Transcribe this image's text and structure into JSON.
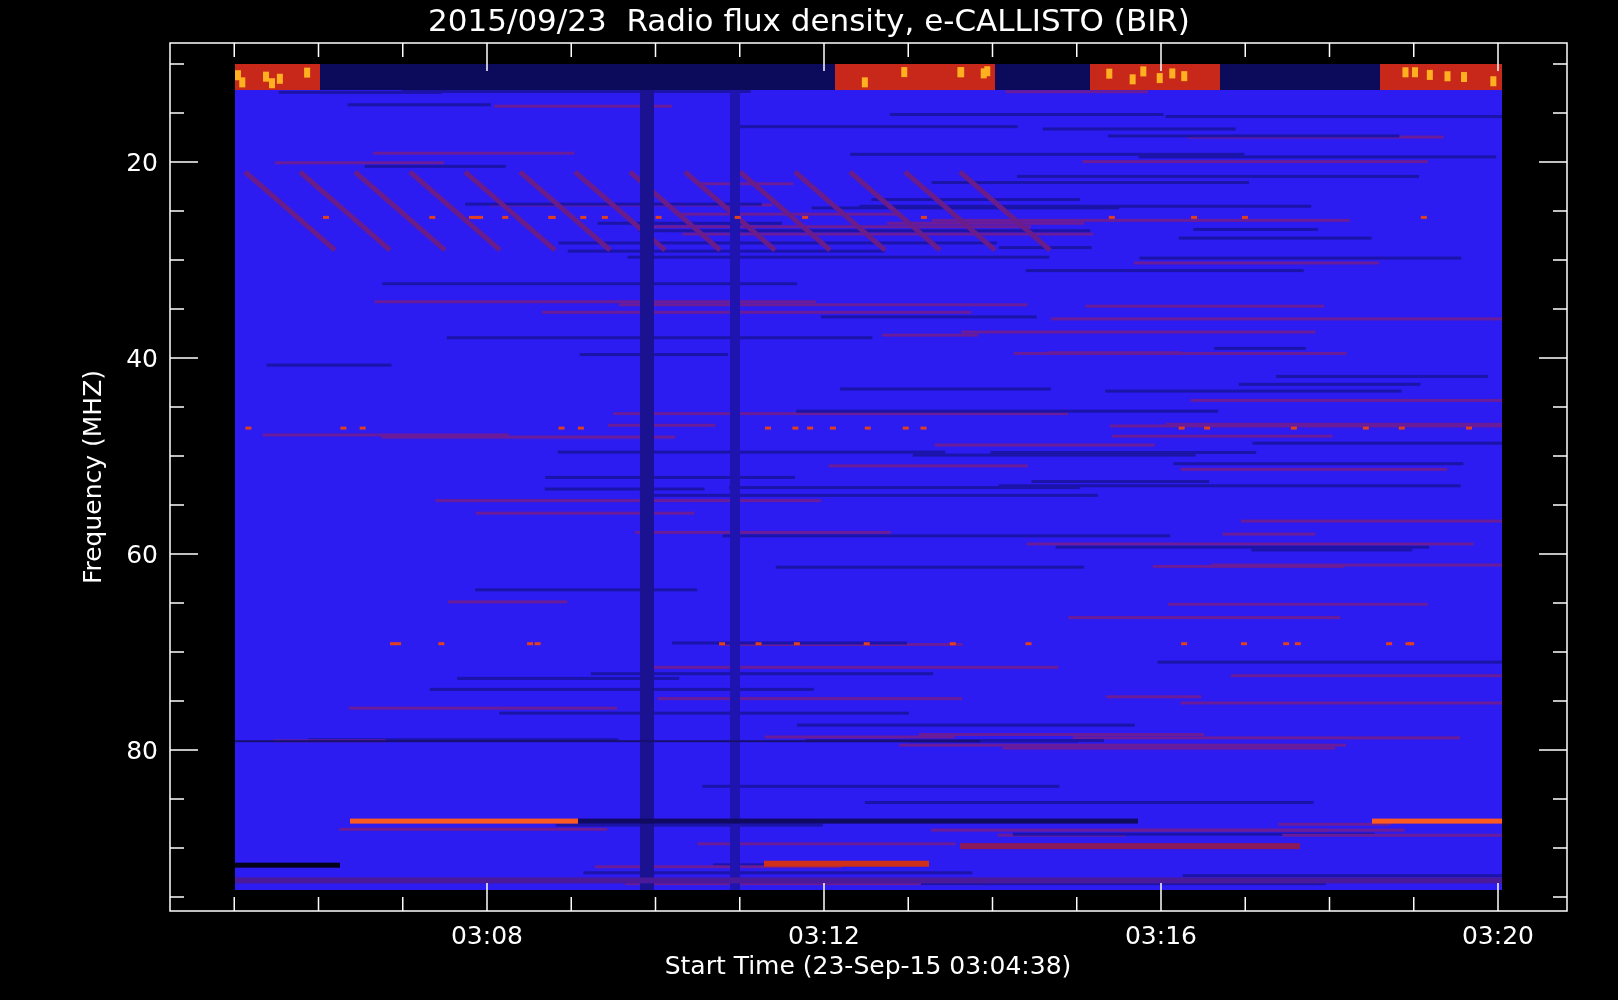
{
  "title": "2015/09/23  Radio flux density, e-CALLISTO (BIR)",
  "y_axis": {
    "label": "Frequency (MHZ)",
    "ticks": [
      "20",
      "40",
      "60",
      "80"
    ]
  },
  "x_axis": {
    "label": "Start Time (23-Sep-15 03:04:38)",
    "ticks": [
      "03:08",
      "03:12",
      "03:16",
      "03:20"
    ]
  }
}
